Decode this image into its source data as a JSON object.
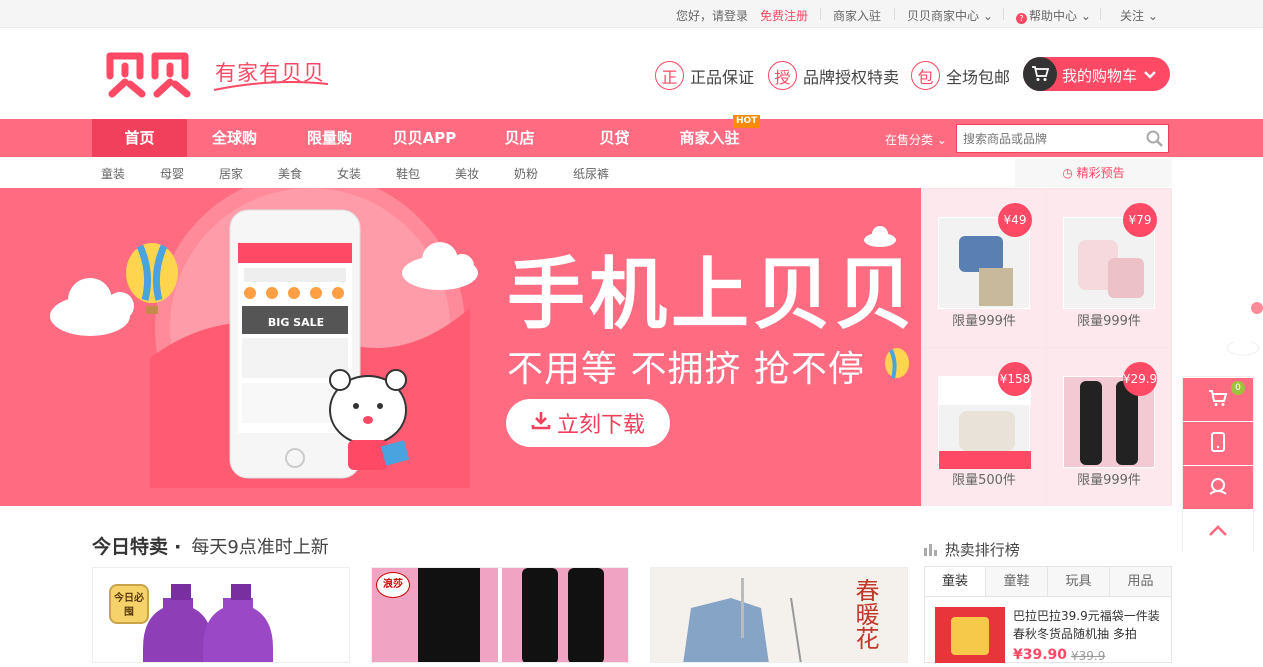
{
  "topbar": {
    "greeting": "您好，请登录",
    "register": "免费注册",
    "merchant_join": "商家入驻",
    "merchant_center": "贝贝商家中心",
    "help_center": "帮助中心",
    "follow": "关注"
  },
  "header": {
    "slogan": "有家有贝贝",
    "promises": [
      {
        "icon": "正",
        "label": "正品保证"
      },
      {
        "icon": "授",
        "label": "品牌授权特卖"
      },
      {
        "icon": "包",
        "label": "全场包邮"
      }
    ],
    "cart_label": "我的购物车"
  },
  "nav": {
    "items": [
      "首页",
      "全球购",
      "限量购",
      "贝贝APP",
      "贝店",
      "贝贷",
      "商家入驻"
    ],
    "hot_badge": "HOT",
    "category_select": "在售分类",
    "search_placeholder": "搜索商品或品牌"
  },
  "subnav": {
    "items": [
      "童装",
      "母婴",
      "居家",
      "美食",
      "女装",
      "鞋包",
      "美妆",
      "奶粉",
      "纸尿裤"
    ],
    "preview": "精彩预告"
  },
  "banner": {
    "title": "手机上贝贝",
    "subtitle": "不用等 不拥挤 抢不停",
    "download": "立刻下载",
    "phone_sale": "BIG SALE"
  },
  "grid": [
    {
      "price": "¥49",
      "limit": "限量999件"
    },
    {
      "price": "¥79",
      "limit": "限量999件"
    },
    {
      "price": "¥158",
      "limit": "限量500件"
    },
    {
      "price": "¥29.9",
      "limit": "限量999件"
    }
  ],
  "sidebar": {
    "cart_count": "0"
  },
  "today": {
    "title": "今日特卖",
    "dot": "·",
    "subtitle": "每天9点准时上新"
  },
  "cards": [
    {
      "badge": "今日必囤"
    },
    {
      "brand": "浪莎"
    },
    {
      "title": "春暖花"
    }
  ],
  "ranking": {
    "title": "热卖排行榜",
    "tabs": [
      "童装",
      "童鞋",
      "玩具",
      "用品"
    ],
    "item": {
      "title": "巴拉巴拉39.9元福袋一件装 春秋冬货品随机抽 多拍",
      "price": "¥39.90",
      "original": "¥39.9"
    }
  },
  "colors": {
    "accent": "#ff4965",
    "nav": "#ff6b81",
    "nav_active": "#f0405c"
  }
}
